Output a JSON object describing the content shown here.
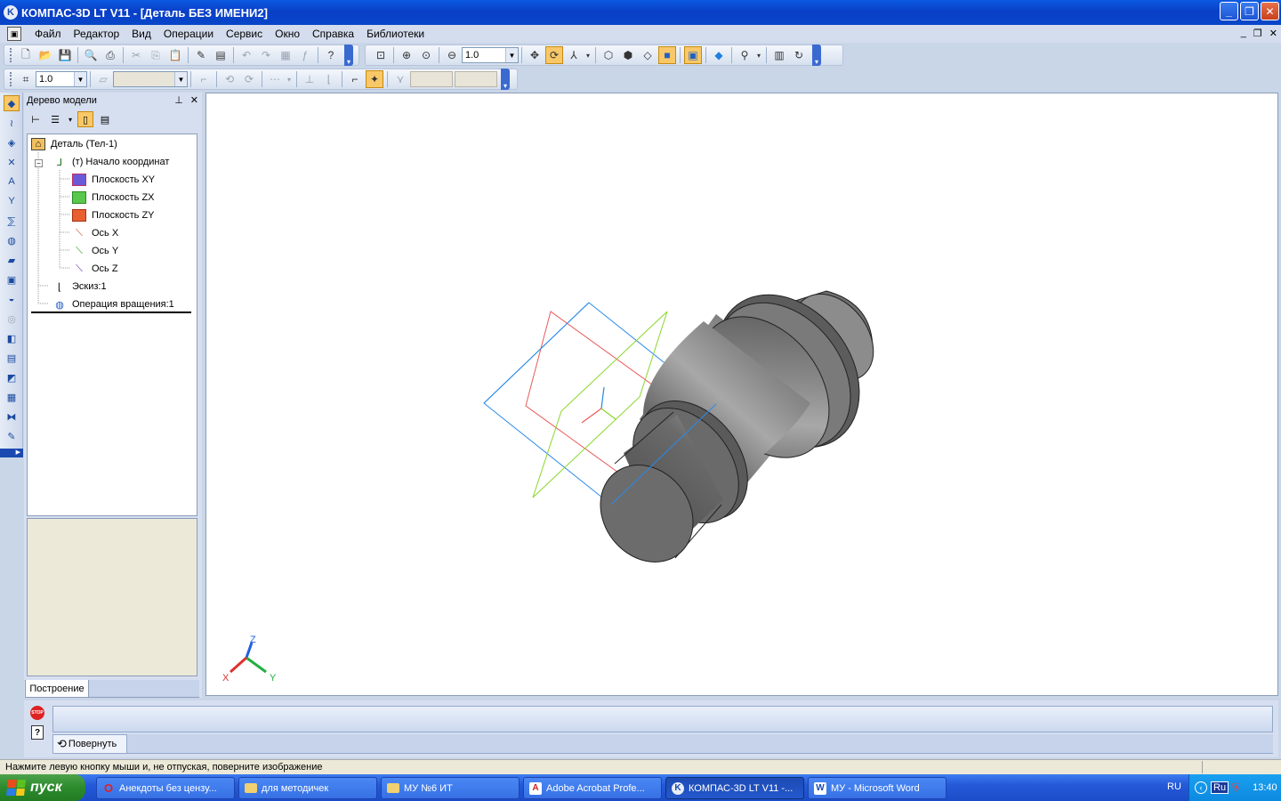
{
  "window": {
    "title": "КОМПАС-3D LT V11 - [Деталь БЕЗ ИМЕНИ2]",
    "app_icon": "K",
    "controls": [
      "minimize-icon",
      "restore-icon",
      "close-icon"
    ]
  },
  "menu": {
    "items": [
      "Файл",
      "Редактор",
      "Вид",
      "Операции",
      "Сервис",
      "Окно",
      "Справка",
      "Библиотеки"
    ]
  },
  "toolbar1": {
    "zoom_value": "1.0"
  },
  "toolbar2": {
    "scale_value": "1.0"
  },
  "tree": {
    "title": "Дерево модели",
    "items": [
      {
        "label": "Деталь (Тел-1)",
        "icon": "part-icon"
      },
      {
        "label": "(т) Начало координат",
        "icon": "origin-icon"
      },
      {
        "label": "Плоскость XY",
        "icon": "plane-xy-icon"
      },
      {
        "label": "Плоскость ZX",
        "icon": "plane-zx-icon"
      },
      {
        "label": "Плоскость ZY",
        "icon": "plane-zy-icon"
      },
      {
        "label": "Ось X",
        "icon": "axis-x-icon"
      },
      {
        "label": "Ось Y",
        "icon": "axis-y-icon"
      },
      {
        "label": "Ось Z",
        "icon": "axis-z-icon"
      },
      {
        "label": "Эскиз:1",
        "icon": "sketch-icon"
      },
      {
        "label": "Операция вращения:1",
        "icon": "revolve-icon"
      }
    ],
    "tab": "Построение"
  },
  "viewport": {
    "triad_labels": {
      "x": "X",
      "y": "Y",
      "z": "Z"
    },
    "colors": {
      "x_axis": "#e03030",
      "y_axis": "#20b040",
      "z_axis": "#2060e0",
      "plane_xy": "#2a8ae8",
      "plane_zx": "#e85a5a",
      "plane_zy": "#8ad62a",
      "body": "#7a7a7a"
    }
  },
  "command_panel": {
    "tab_label": "Повернуть"
  },
  "status": {
    "text": "Нажмите левую кнопку мыши и, не отпуская, поверните изображение"
  },
  "taskbar": {
    "start_label": "пуск",
    "tasks": [
      {
        "label": "Анекдоты без цензу...",
        "icon": "opera-icon",
        "active": false
      },
      {
        "label": "для методичек",
        "icon": "folder-icon",
        "active": false
      },
      {
        "label": "МУ №6 ИТ",
        "icon": "folder-icon",
        "active": false
      },
      {
        "label": "Adobe Acrobat Profe...",
        "icon": "acrobat-icon",
        "active": false
      },
      {
        "label": "КОМПАС-3D LT V11 -...",
        "icon": "kompas-icon",
        "active": true
      },
      {
        "label": "МУ - Microsoft Word",
        "icon": "word-icon",
        "active": false
      }
    ],
    "lang": "RU",
    "tray_lang": "Ru",
    "clock": "13:40"
  }
}
